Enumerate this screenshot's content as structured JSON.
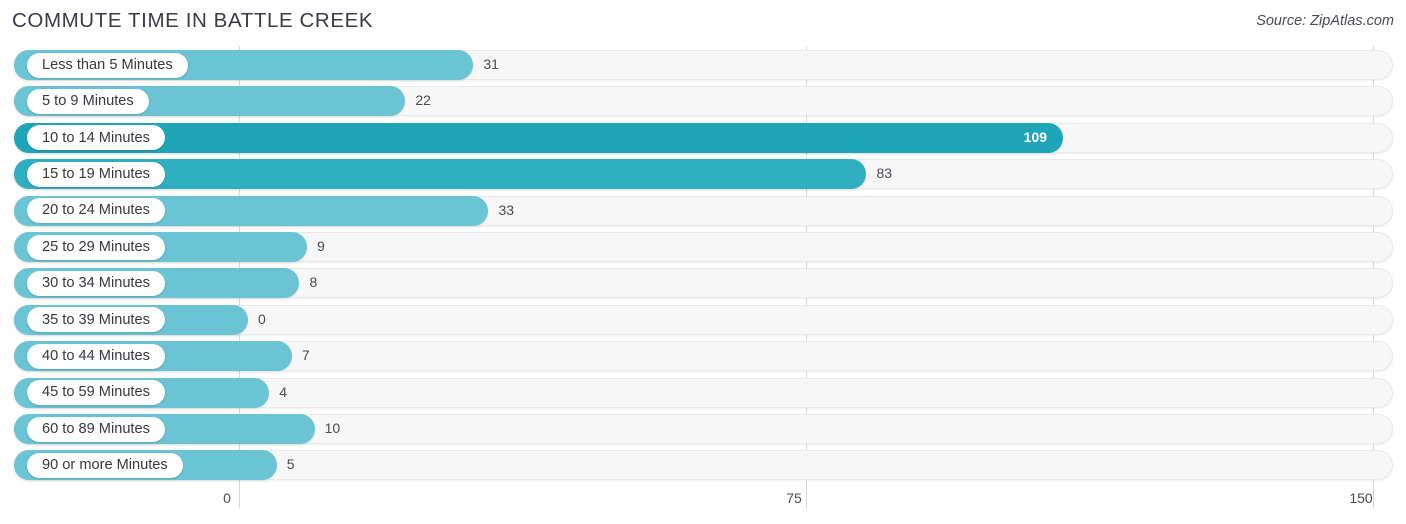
{
  "header": {
    "title": "COMMUTE TIME IN BATTLE CREEK",
    "source": "Source: ZipAtlas.com"
  },
  "colors": {
    "bar_light": "#6BC4D3",
    "bar_dark": "#1FA5B8",
    "bar_mid": "#2FAEBF",
    "track": "#f7f7f7",
    "gridline": "#d8d8d8",
    "title_text": "#3b3b47",
    "value_text": "#4a4a52"
  },
  "chart_data": {
    "type": "bar",
    "orientation": "horizontal",
    "title": "COMMUTE TIME IN BATTLE CREEK",
    "subtitle": "",
    "xlabel": "",
    "ylabel": "",
    "xlim": [
      0,
      150
    ],
    "grid": true,
    "legend": null,
    "xticks": [
      "0",
      "75",
      "150"
    ],
    "xtick_values": [
      0,
      75,
      150
    ],
    "categories": [
      "Less than 5 Minutes",
      "5 to 9 Minutes",
      "10 to 14 Minutes",
      "15 to 19 Minutes",
      "20 to 24 Minutes",
      "25 to 29 Minutes",
      "30 to 34 Minutes",
      "35 to 39 Minutes",
      "40 to 44 Minutes",
      "45 to 59 Minutes",
      "60 to 89 Minutes",
      "90 or more Minutes"
    ],
    "values": [
      31,
      22,
      109,
      83,
      33,
      9,
      8,
      0,
      7,
      4,
      10,
      5
    ],
    "value_labels": [
      "31",
      "22",
      "109",
      "83",
      "33",
      "9",
      "8",
      "0",
      "7",
      "4",
      "10",
      "5"
    ],
    "bar_colors": [
      "#6BC4D3",
      "#6BC4D3",
      "#1FA5B8",
      "#2FAEBF",
      "#6BC4D3",
      "#6BC4D3",
      "#6BC4D3",
      "#6BC4D3",
      "#6BC4D3",
      "#6BC4D3",
      "#6BC4D3",
      "#6BC4D3"
    ],
    "label_inside": [
      false,
      false,
      true,
      false,
      false,
      false,
      false,
      false,
      false,
      false,
      false,
      false
    ]
  }
}
